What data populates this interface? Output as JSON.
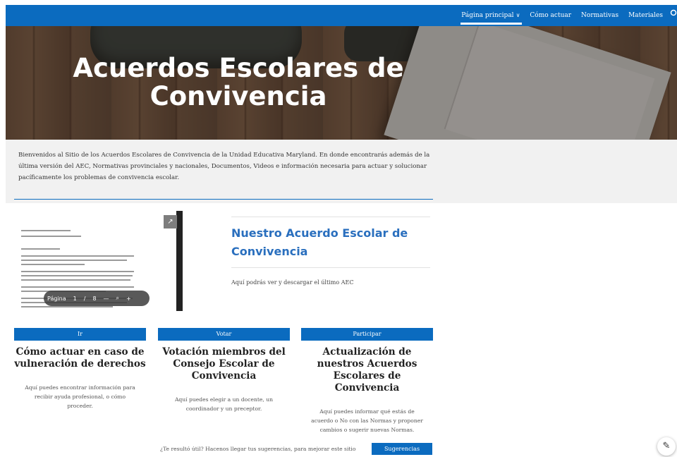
{
  "nav": {
    "items": [
      {
        "label": "Página principal",
        "active": true,
        "has_dropdown": true
      },
      {
        "label": "Cómo actuar",
        "active": false,
        "has_dropdown": false
      },
      {
        "label": "Normativas",
        "active": false,
        "has_dropdown": false
      },
      {
        "label": "Materiales",
        "active": false,
        "has_dropdown": false
      }
    ],
    "search_icon": "search-icon",
    "chevron_icon": "chevron-down-icon"
  },
  "hero": {
    "title_line1": "Acuerdos Escolares de",
    "title_line2": "Convivencia"
  },
  "intro": {
    "text": "Bienvenidos al Sitio de los Acuerdos Escolares de Convivencia de la Unidad Educativa Maryland. En donde encontrarás además de la última versión del AEC, Normativas provinciales y nacionales, Documentos, Videos e información necesaria para actuar y solucionar pacíficamente los problemas de convivencia escolar."
  },
  "document": {
    "pager_label": "Página",
    "current_page": "1",
    "separator": "/",
    "total_pages": "8",
    "zoom_out": "—",
    "zoom_in": "+",
    "open_icon": "open-external-icon",
    "zoom_icon": "magnifier-icon"
  },
  "acuerdo": {
    "title": "Nuestro Acuerdo Escolar de Convivencia",
    "description": "Aquí podrás ver y descargar el último AEC"
  },
  "cards": [
    {
      "button": "Ir",
      "title": "Cómo actuar en caso de vulneración de derechos",
      "description": "Aquí puedes encontrar información para recibir ayuda profesional, o cómo proceder."
    },
    {
      "button": "Votar",
      "title": "Votación miembros del Consejo Escolar de Convivencia",
      "description": "Aquí puedes elegir a un docente, un coordinador y un preceptor."
    },
    {
      "button": "Participar",
      "title": "Actualización de nuestros Acuerdos Escolares de Convivencia",
      "description": "Aquí puedes informar qué estás de acuerdo o No con las Normas y proponer cambios o sugerir nuevas Normas."
    }
  ],
  "footer": {
    "suggest_text": "¿Te resultó útil? Hacenos llegar tus sugerencias, para mejorar este sitio",
    "suggest_button": "Sugerencias",
    "edit_icon": "pencil-icon"
  },
  "colors": {
    "primary": "#0b6bbf",
    "title_blue": "#2a6fbe",
    "intro_bg": "#f1f1f1"
  }
}
